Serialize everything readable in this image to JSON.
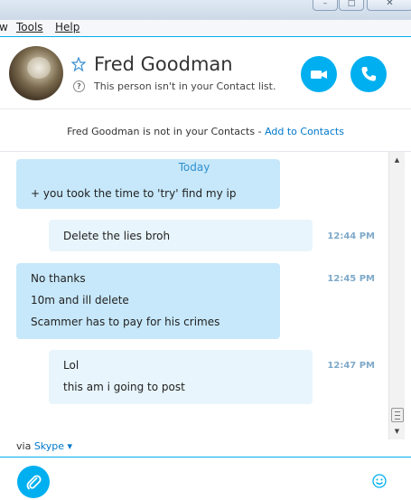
{
  "window": {
    "buttons": [
      "–",
      "□",
      "✕"
    ]
  },
  "menu": {
    "items": [
      "w",
      "Tools",
      "Help"
    ]
  },
  "contact": {
    "name": "Fred Goodman",
    "status": "This person isn't in your Contact list."
  },
  "notice": {
    "text": "Fred Goodman is not in your Contacts - ",
    "link": "Add to Contacts"
  },
  "chat": {
    "date_label": "Today",
    "messages": [
      {
        "lines": [
          "+ you took the time to 'try' find my ip"
        ],
        "time": ""
      },
      {
        "lines": [
          "Delete the lies broh"
        ],
        "time": "12:44 PM"
      },
      {
        "lines": [
          "No thanks",
          "10m and ill delete",
          "Scammer has to pay for his crimes"
        ],
        "time": "12:45 PM"
      },
      {
        "lines": [
          "Lol",
          "this am i going to post"
        ],
        "time": "12:47 PM"
      }
    ]
  },
  "footer": {
    "via_label": "via",
    "via_service": "Skype"
  },
  "colors": {
    "accent": "#00aff0",
    "incoming_bubble": "#c7e8fa",
    "outgoing_bubble": "#e8f5fc",
    "link": "#0078ca"
  },
  "icons": {
    "video": "video-camera-icon",
    "audio": "phone-icon",
    "attach": "paperclip-icon",
    "emoji": "smiley-icon",
    "favorite": "star-icon"
  }
}
